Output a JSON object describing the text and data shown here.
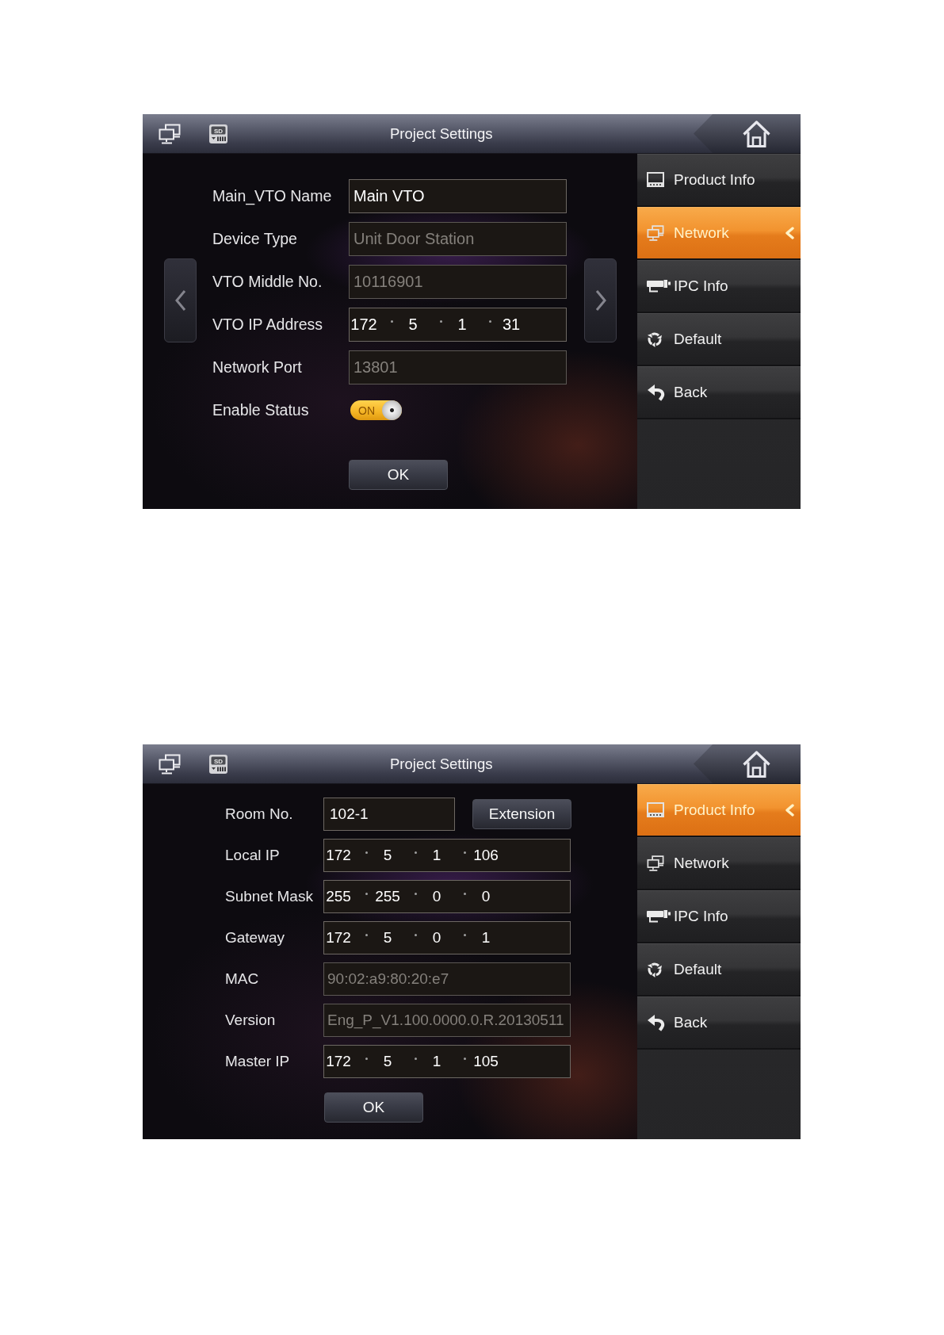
{
  "screens": [
    {
      "header": {
        "sd_label": "SD",
        "title": "Project Settings"
      },
      "page_arrows": true,
      "form": {
        "rows": [
          {
            "kind": "text",
            "label": "Main_VTO Name",
            "value": "Main VTO",
            "disabled": false
          },
          {
            "kind": "text",
            "label": "Device Type",
            "value": "Unit Door Station",
            "disabled": true
          },
          {
            "kind": "text",
            "label": "VTO Middle No.",
            "value": "10116901",
            "disabled": true
          },
          {
            "kind": "ip",
            "label": "VTO IP Address",
            "octets": [
              "172",
              "5",
              "1",
              "31"
            ]
          },
          {
            "kind": "text",
            "label": "Network Port",
            "value": "13801",
            "disabled": true
          },
          {
            "kind": "toggle",
            "label": "Enable Status",
            "on": true,
            "text": "ON"
          }
        ],
        "ok_button": "OK"
      },
      "menu": [
        {
          "kind": "product",
          "label": "Product Info",
          "selected": false
        },
        {
          "kind": "network",
          "label": "Network",
          "selected": true
        },
        {
          "kind": "camera",
          "label": "IPC Info",
          "selected": false
        },
        {
          "kind": "reset",
          "label": "Default",
          "selected": false
        },
        {
          "kind": "back",
          "label": "Back",
          "selected": false
        }
      ]
    },
    {
      "header": {
        "sd_label": "SD",
        "title": "Project Settings"
      },
      "form": {
        "rows": [
          {
            "kind": "combo",
            "label": "Room No.",
            "value": "102-1",
            "disabled": false,
            "button": "Extension"
          },
          {
            "kind": "ip",
            "label": "Local IP",
            "octets": [
              "172",
              "5",
              "1",
              "106"
            ]
          },
          {
            "kind": "ip",
            "label": "Subnet Mask",
            "octets": [
              "255",
              "255",
              "0",
              "0"
            ]
          },
          {
            "kind": "ip",
            "label": "Gateway",
            "octets": [
              "172",
              "5",
              "0",
              "1"
            ]
          },
          {
            "kind": "text",
            "label": "MAC",
            "value": "90:02:a9:80:20:e7",
            "disabled": true
          },
          {
            "kind": "text",
            "label": "Version",
            "value": "Eng_P_V1.100.0000.0.R.20130511",
            "disabled": true
          },
          {
            "kind": "ip",
            "label": "Master IP",
            "octets": [
              "172",
              "5",
              "1",
              "105"
            ]
          }
        ],
        "ok_button": "OK"
      },
      "menu": [
        {
          "kind": "product",
          "label": "Product Info",
          "selected": true
        },
        {
          "kind": "network",
          "label": "Network",
          "selected": false
        },
        {
          "kind": "camera",
          "label": "IPC Info",
          "selected": false
        },
        {
          "kind": "reset",
          "label": "Default",
          "selected": false
        },
        {
          "kind": "back",
          "label": "Back",
          "selected": false
        }
      ]
    }
  ]
}
